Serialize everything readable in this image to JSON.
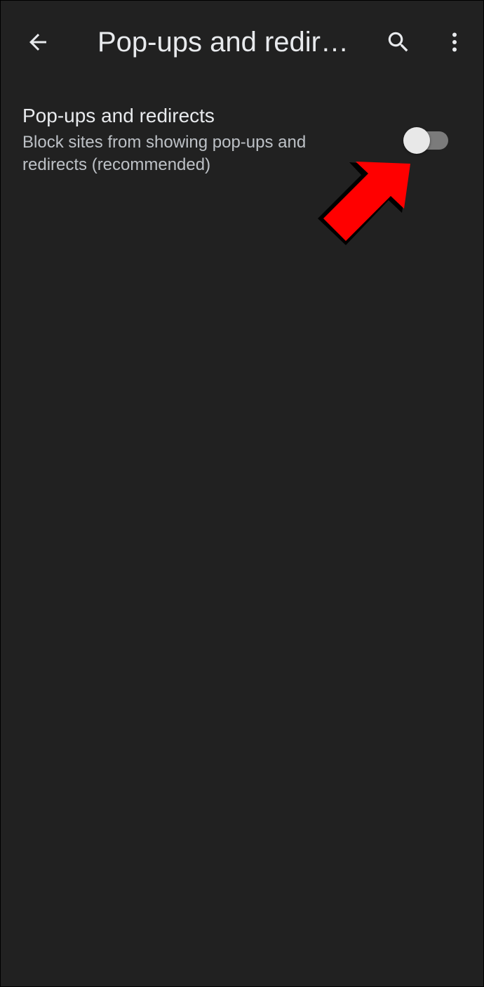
{
  "toolbar": {
    "title": "Pop-ups and redir…",
    "back_icon": "arrow-back-icon",
    "search_icon": "search-icon",
    "more_icon": "more-vert-icon"
  },
  "setting": {
    "title": "Pop-ups and redirects",
    "summary": "Block sites from showing pop-ups and redirects (recommended)",
    "enabled": false
  },
  "colors": {
    "background": "#212121",
    "text_primary": "#e8eaed",
    "text_secondary": "#bdc1c6",
    "switch_track_off": "#7b7b7b",
    "switch_thumb_off": "#e8e8e8",
    "annotation_arrow": "#ff0000"
  }
}
